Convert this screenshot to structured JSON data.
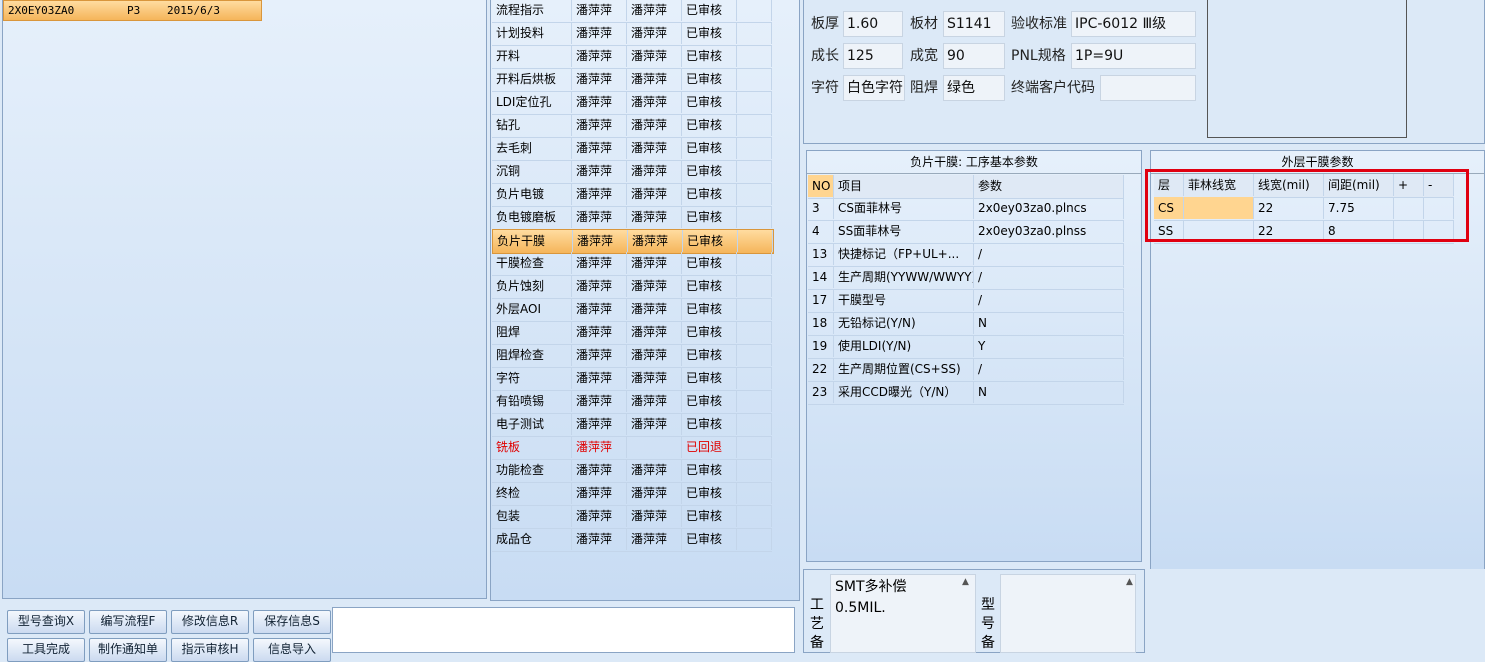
{
  "order": {
    "code": "2X0EY03ZA0",
    "rev": "P3",
    "date": "2015/6/3"
  },
  "process_rows": [
    {
      "name": "流程指示",
      "a": "潘萍萍",
      "b": "潘萍萍",
      "status": "已审核"
    },
    {
      "name": "计划投料",
      "a": "潘萍萍",
      "b": "潘萍萍",
      "status": "已审核"
    },
    {
      "name": "开料",
      "a": "潘萍萍",
      "b": "潘萍萍",
      "status": "已审核"
    },
    {
      "name": "开料后烘板",
      "a": "潘萍萍",
      "b": "潘萍萍",
      "status": "已审核"
    },
    {
      "name": "LDI定位孔",
      "a": "潘萍萍",
      "b": "潘萍萍",
      "status": "已审核"
    },
    {
      "name": "钻孔",
      "a": "潘萍萍",
      "b": "潘萍萍",
      "status": "已审核"
    },
    {
      "name": "去毛刺",
      "a": "潘萍萍",
      "b": "潘萍萍",
      "status": "已审核"
    },
    {
      "name": "沉铜",
      "a": "潘萍萍",
      "b": "潘萍萍",
      "status": "已审核"
    },
    {
      "name": "负片电镀",
      "a": "潘萍萍",
      "b": "潘萍萍",
      "status": "已审核"
    },
    {
      "name": "负电镀磨板",
      "a": "潘萍萍",
      "b": "潘萍萍",
      "status": "已审核"
    },
    {
      "name": "负片干膜",
      "a": "潘萍萍",
      "b": "潘萍萍",
      "status": "已审核"
    },
    {
      "name": "干膜检查",
      "a": "潘萍萍",
      "b": "潘萍萍",
      "status": "已审核"
    },
    {
      "name": "负片蚀刻",
      "a": "潘萍萍",
      "b": "潘萍萍",
      "status": "已审核"
    },
    {
      "name": "外层AOI",
      "a": "潘萍萍",
      "b": "潘萍萍",
      "status": "已审核"
    },
    {
      "name": "阻焊",
      "a": "潘萍萍",
      "b": "潘萍萍",
      "status": "已审核"
    },
    {
      "name": "阻焊检查",
      "a": "潘萍萍",
      "b": "潘萍萍",
      "status": "已审核"
    },
    {
      "name": "字符",
      "a": "潘萍萍",
      "b": "潘萍萍",
      "status": "已审核"
    },
    {
      "name": "有铅喷锡",
      "a": "潘萍萍",
      "b": "潘萍萍",
      "status": "已审核"
    },
    {
      "name": "电子测试",
      "a": "潘萍萍",
      "b": "潘萍萍",
      "status": "已审核"
    },
    {
      "name": "铣板",
      "a": "潘萍萍",
      "b": "",
      "status": "已回退"
    },
    {
      "name": "功能检查",
      "a": "潘萍萍",
      "b": "潘萍萍",
      "status": "已审核"
    },
    {
      "name": "终检",
      "a": "潘萍萍",
      "b": "潘萍萍",
      "status": "已审核"
    },
    {
      "name": "包装",
      "a": "潘萍萍",
      "b": "潘萍萍",
      "status": "已审核"
    },
    {
      "name": "成品仓",
      "a": "潘萍萍",
      "b": "潘萍萍",
      "status": "已审核"
    }
  ],
  "info": {
    "thickness_label": "板厚",
    "thickness": "1.60",
    "material_label": "板材",
    "material": "S1141",
    "standard_label": "验收标准",
    "standard": "IPC-6012 Ⅲ级",
    "length_label": "成长",
    "length": "125",
    "width_label": "成宽",
    "width": "90",
    "pnl_label": "PNL规格",
    "pnl": "1P=9U",
    "legend_label": "字符",
    "legend": "白色字符",
    "mask_label": "阻焊",
    "mask": "绿色",
    "customer_label": "终端客户代码",
    "customer": ""
  },
  "params": {
    "title": "负片干膜: 工序基本参数",
    "col_no": "NO",
    "col_item": "项目",
    "col_value": "参数",
    "rows": [
      {
        "no": "3",
        "item": "CS面菲林号",
        "value": "2x0ey03za0.plncs"
      },
      {
        "no": "4",
        "item": "SS面菲林号",
        "value": "2x0ey03za0.plnss"
      },
      {
        "no": "13",
        "item": "快捷标记（FP+UL+...",
        "value": "/"
      },
      {
        "no": "14",
        "item": "生产周期(YYWW/WWYY)",
        "value": "/"
      },
      {
        "no": "17",
        "item": "干膜型号",
        "value": "/"
      },
      {
        "no": "18",
        "item": "无铅标记(Y/N)",
        "value": "N"
      },
      {
        "no": "19",
        "item": "使用LDI(Y/N)",
        "value": "Y"
      },
      {
        "no": "22",
        "item": "生产周期位置(CS+SS)",
        "value": "/"
      },
      {
        "no": "23",
        "item": "采用CCD曝光（Y/N）",
        "value": "N"
      }
    ]
  },
  "outer": {
    "title": "外层干膜参数",
    "headers": [
      "层",
      "菲林线宽",
      "线宽(mil)",
      "间距(mil)",
      "+",
      "-"
    ],
    "rows": [
      {
        "layer": "CS",
        "film": "",
        "width": "22",
        "space": "7.75"
      },
      {
        "layer": "SS",
        "film": "",
        "width": "22",
        "space": "8"
      }
    ]
  },
  "buttons": {
    "query": "型号查询X",
    "flow": "编写流程F",
    "modify": "修改信息R",
    "save": "保存信息S",
    "tool": "工具完成",
    "notice": "制作通知单",
    "audit": "指示审核H",
    "import": "信息导入"
  },
  "remark": {
    "label": "工艺备",
    "text1": "SMT多补偿",
    "text2": "0.5MIL.",
    "type_label": "型号备"
  }
}
